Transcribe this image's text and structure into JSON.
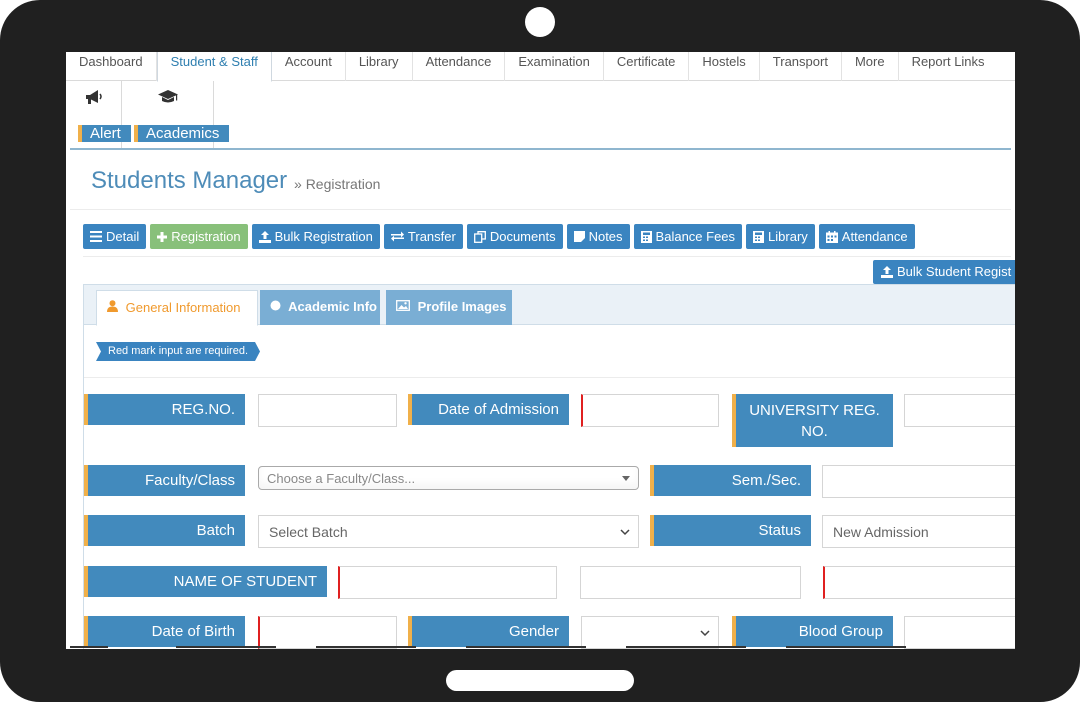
{
  "topnav": {
    "tabs": [
      "Dashboard",
      "Student & Staff",
      "Account",
      "Library",
      "Attendance",
      "Examination",
      "Certificate",
      "Hostels",
      "Transport",
      "More",
      "Report Links"
    ],
    "active_index": 1
  },
  "subnav": {
    "items": [
      {
        "label": "Alert",
        "icon": "bullhorn-icon"
      },
      {
        "label": "Academics",
        "icon": "graduation-cap-icon"
      }
    ]
  },
  "page": {
    "title": "Students Manager",
    "crumb_sep": "»",
    "crumb": "Registration"
  },
  "actions": {
    "detail": "Detail",
    "registration": "Registration",
    "bulk_registration": "Bulk Registration",
    "transfer": "Transfer",
    "documents": "Documents",
    "notes": "Notes",
    "balance_fees": "Balance Fees",
    "library": "Library",
    "attendance": "Attendance",
    "bulk_student": "Bulk Student Regist"
  },
  "panel": {
    "tabs": {
      "general": "General Information",
      "academic": "Academic Info",
      "profile": "Profile Images"
    },
    "note": "Red mark input are required."
  },
  "form": {
    "reg_no": "REG.NO.",
    "date_of_admission": "Date of Admission",
    "university_reg_1": "UNIVERSITY REG.",
    "university_reg_2": "NO.",
    "faculty_class": "Faculty/Class",
    "faculty_placeholder": "Choose a Faculty/Class...",
    "sem_sec": "Sem./Sec.",
    "batch": "Batch",
    "batch_value": "Select Batch",
    "status": "Status",
    "status_value": "New Admission",
    "name_of_student": "NAME OF STUDENT",
    "date_of_birth": "Date of Birth",
    "gender": "Gender",
    "blood_group": "Blood Group"
  },
  "colors": {
    "primary": "#3a84c0",
    "label_bg": "#428abd",
    "label_accent": "#f0b04a",
    "success": "#88c07a",
    "required": "#e02020",
    "active_tab_text": "#f09a2e"
  }
}
